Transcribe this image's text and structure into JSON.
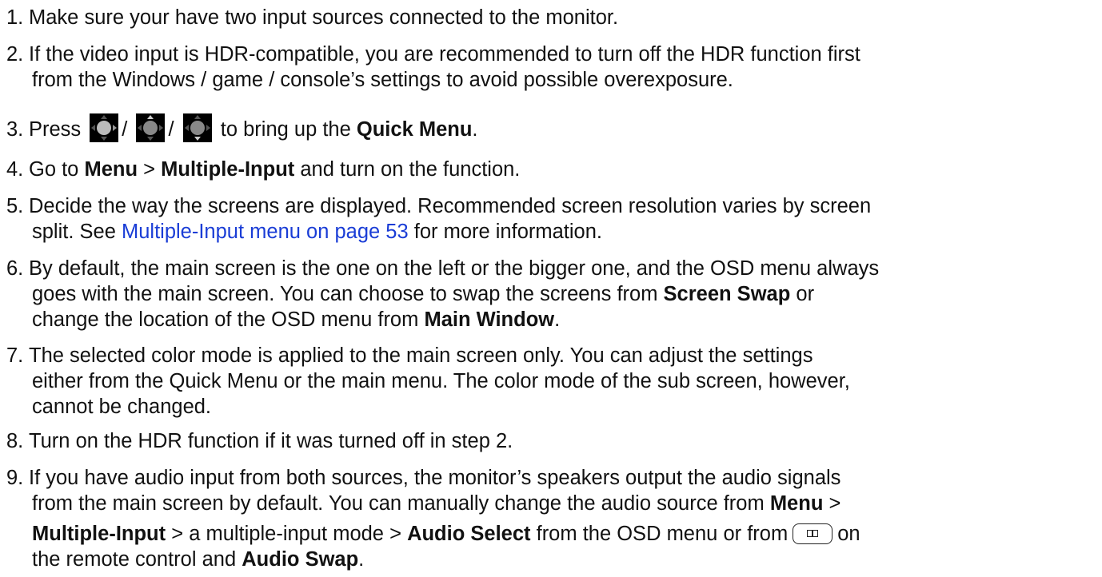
{
  "steps": [
    {
      "num": "1.",
      "t1": "Make sure your have two input sources connected to the monitor."
    },
    {
      "num": "2.",
      "l1": "If the video input is HDR-compatible, you are recommended to turn off the HDR function first",
      "l2": "from the Windows / game / console’s settings to avoid possible overexposure."
    },
    {
      "num": "3.",
      "a": "Press",
      "sep1": "/",
      "sep2": "/",
      "b": "to bring up the",
      "bold": "Quick Menu",
      "end": "."
    },
    {
      "num": "4.",
      "a": "Go to",
      "b1": "Menu",
      "gt": ">",
      "b2": "Multiple-Input",
      "c": "and turn on the function."
    },
    {
      "num": "5.",
      "l1": "Decide the way the screens are displayed. Recommended screen resolution varies by screen",
      "l2a": "split. See",
      "link": "Multiple-Input menu on page 53",
      "l2b": "for more information."
    },
    {
      "num": "6.",
      "l1": "By default, the main screen is the one on the left or the bigger one, and the OSD menu always",
      "l2a": "goes with the main screen. You can choose to swap the screens from",
      "b1": "Screen Swap",
      "l2b": "or",
      "l3a": "change the location of the OSD menu from",
      "b2": "Main Window",
      "l3b": "."
    },
    {
      "num": "7.",
      "l1": "The selected color mode is applied to the main screen only. You can adjust the settings",
      "l2": "either from the Quick Menu or the main menu. The color mode of the sub screen, however,",
      "l3": "cannot be changed."
    },
    {
      "num": "8.",
      "t1": "Turn on the HDR function if it was turned off in step 2."
    },
    {
      "num": "9.",
      "l1": "If you have audio input from both sources, the monitor’s speakers output the audio signals",
      "l2a": "from the main screen by default. You can manually change the audio source from",
      "b1": "Menu",
      "l2b": ">",
      "b2": "Multiple-Input",
      "l3a": "> a multiple-input mode >",
      "b3": "Audio Select",
      "l3b": "from the OSD menu or from",
      "l3c": "on",
      "l4a": "the remote control and",
      "b4": "Audio Swap",
      "l4b": "."
    }
  ],
  "icons": {
    "joystick": "joystick-icon",
    "remote": "remote-pip-button-icon"
  }
}
